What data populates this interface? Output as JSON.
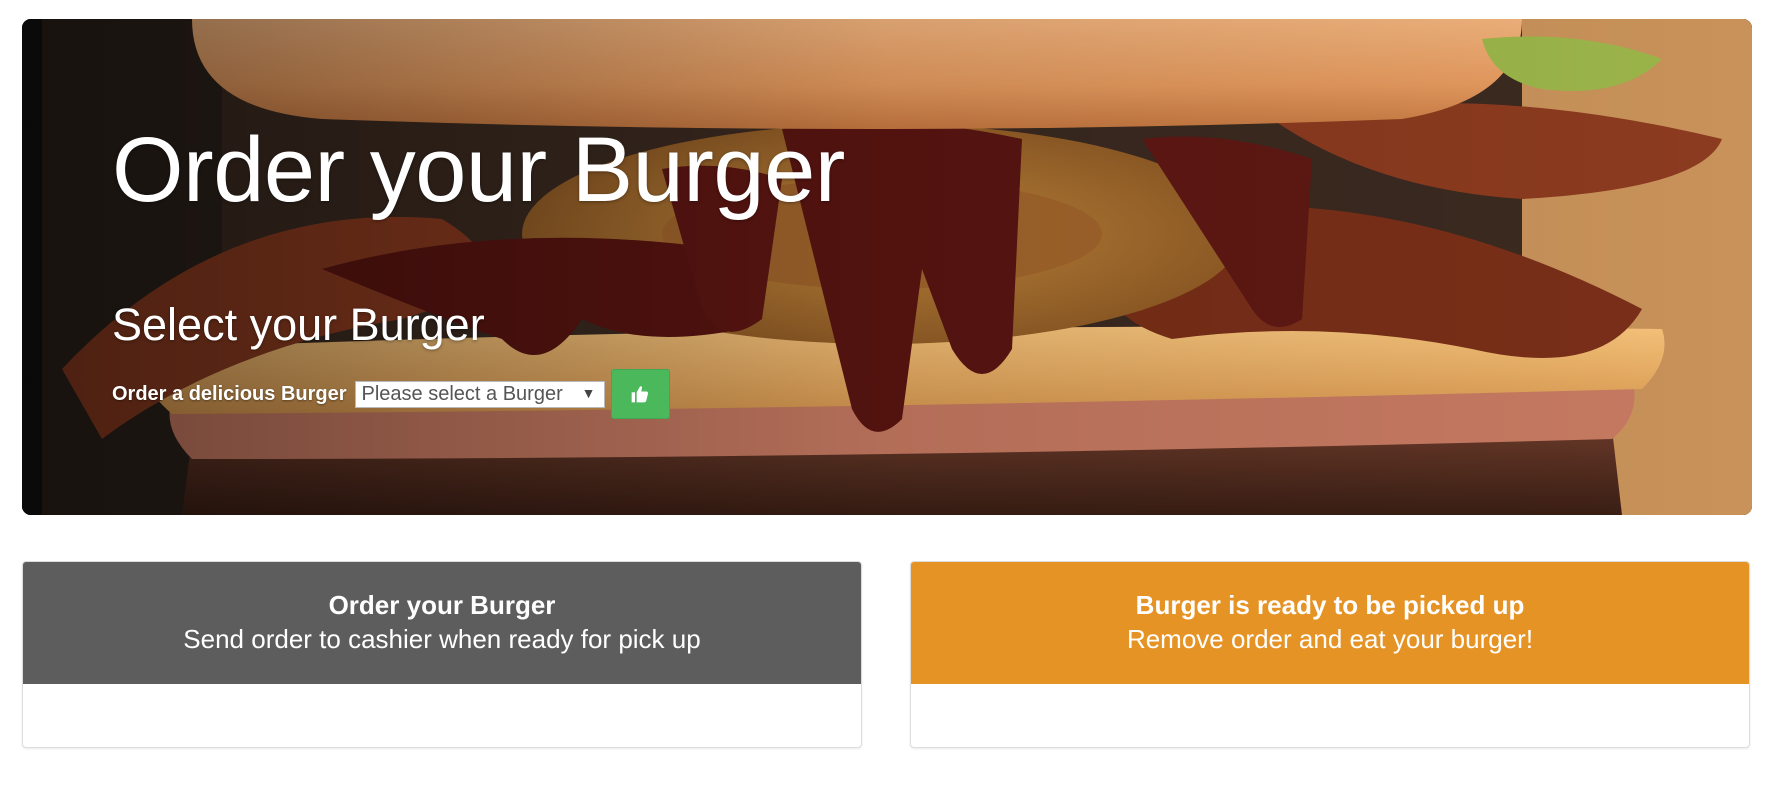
{
  "hero": {
    "title": "Order your Burger",
    "subtitle": "Select your Burger",
    "order_label": "Order a delicious Burger",
    "select": {
      "selected": "Please select a Burger"
    },
    "submit_icon": "thumbs-up-icon",
    "background_image": "burger-photo"
  },
  "panels": {
    "order": {
      "title": "Order your Burger",
      "description": "Send order to cashier when ready for pick up",
      "header_color": "#5d5d5d"
    },
    "ready": {
      "title": "Burger is ready to be picked up",
      "description": "Remove order and eat your burger!",
      "header_color": "#e69325"
    }
  },
  "colors": {
    "submit_button": "#4cb85c"
  }
}
